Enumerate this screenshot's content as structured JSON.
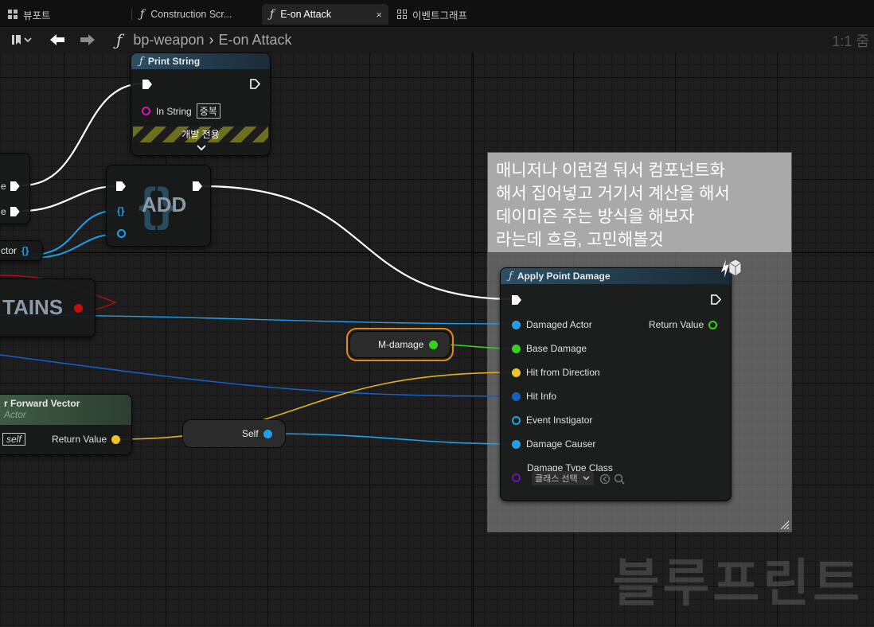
{
  "tabs": [
    {
      "label": "뷰포트",
      "active": false
    },
    {
      "label": "Construction Scr...",
      "active": false
    },
    {
      "label": "E-on Attack",
      "active": true
    },
    {
      "label": "이벤트그래프",
      "active": false
    }
  ],
  "tab_close_symbol": "×",
  "breadcrumb": {
    "blueprint": "bp-weapon",
    "function": "E-on Attack"
  },
  "zoom_label": "1:1 줌",
  "nodes": {
    "print_string": {
      "title": "Print String",
      "in_string_label": "In String",
      "in_string_value": "중복",
      "dev_only_label": "개발 전용"
    },
    "add": {
      "title": "ADD"
    },
    "contains": {
      "title": "TAINS"
    },
    "partial_left": {
      "pin_top": "e",
      "pin_bottom": "e",
      "actor_label": "ctor"
    },
    "forward_vector": {
      "title": "r Forward Vector",
      "subtitle": "Actor",
      "target_value": "self",
      "return_label": "Return Value"
    },
    "self_var": {
      "label": "Self"
    },
    "damage_var": {
      "label": "M-damage"
    },
    "apply_point_damage": {
      "title": "Apply Point Damage",
      "pins": {
        "damaged_actor": "Damaged Actor",
        "base_damage": "Base Damage",
        "hit_from_direction": "Hit from Direction",
        "hit_info": "Hit Info",
        "event_instigator": "Event Instigator",
        "damage_causer": "Damage Causer",
        "damage_type_class": "Damage Type Class"
      },
      "return_value": "Return Value",
      "class_select": "클래스 선택"
    }
  },
  "comment": {
    "text_lines": [
      "매니저나 이런걸 둬서 컴포넌트화",
      "해서 집어넣고 거기서 계산을 해서",
      "데이미즌 주는 방식을 해보자",
      "라는데 흐음, 고민해볼것"
    ]
  },
  "watermark": "블루프린트",
  "colors": {
    "exec": "#ffffff",
    "object": "#1ea0e8",
    "float": "#35d21c",
    "vector": "#f0c324",
    "struct": "#1460c8",
    "string": "#e010b0",
    "class": "#6a14b0",
    "header": "#2d4f66",
    "accent_tab": "#242424"
  },
  "icons": [
    "function-icon",
    "bookmark-icon",
    "back-arrow-icon",
    "forward-arrow-icon",
    "blueprint-graph-icon",
    "latent-icon"
  ]
}
